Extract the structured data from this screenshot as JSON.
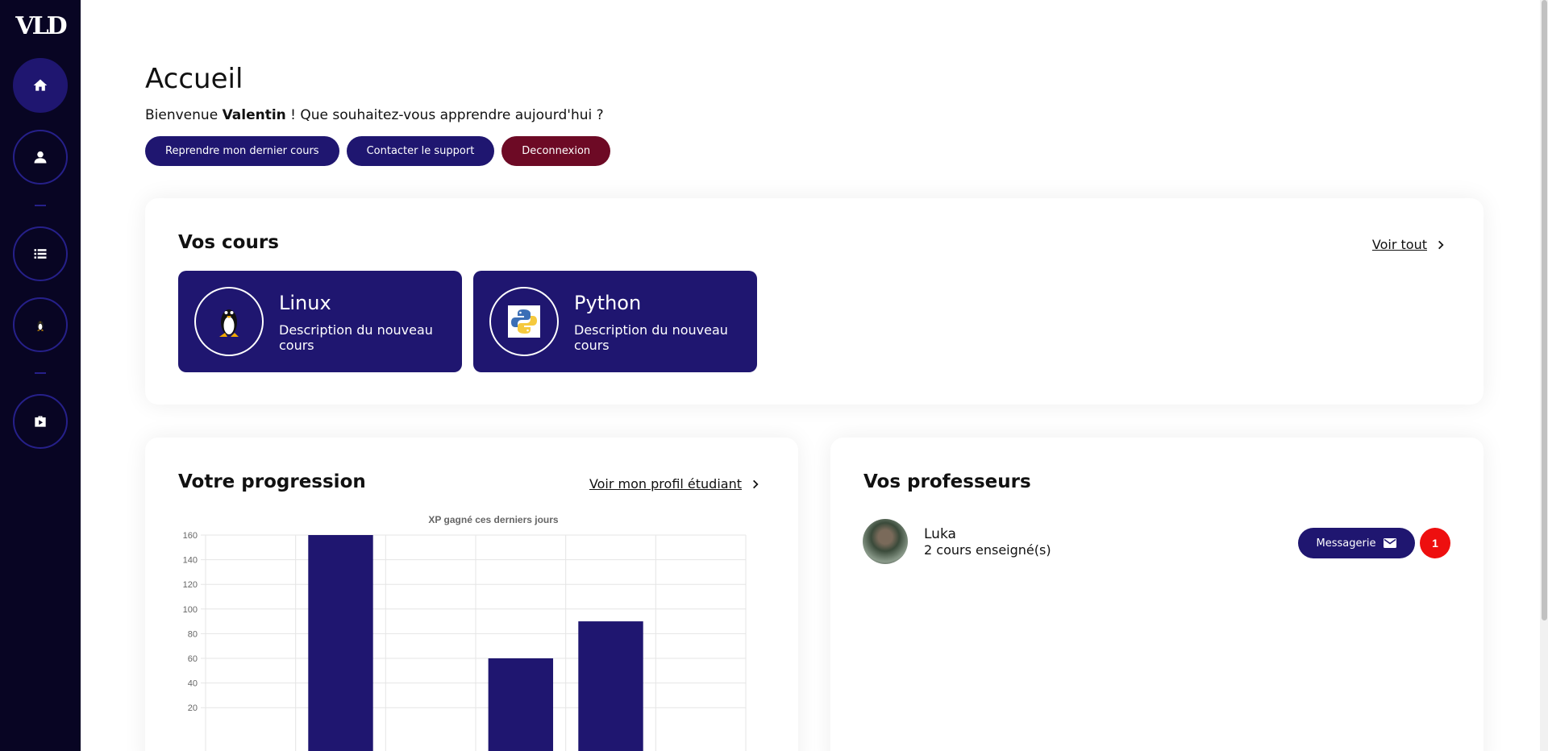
{
  "app": {
    "logo": "VLD"
  },
  "sidebar": {
    "items": [
      {
        "icon": "home-icon",
        "active": true
      },
      {
        "icon": "user-icon",
        "active": false
      },
      {
        "icon": "list-icon",
        "active": false
      },
      {
        "icon": "linux-icon",
        "active": false
      },
      {
        "icon": "briefcase-icon",
        "active": false
      }
    ]
  },
  "header": {
    "title": "Accueil",
    "welcome_prefix": "Bienvenue ",
    "user_name": "Valentin",
    "welcome_suffix": " ! Que souhaitez-vous apprendre aujourd'hui ?",
    "buttons": {
      "resume": "Reprendre mon dernier cours",
      "support": "Contacter le support",
      "logout": "Deconnexion"
    }
  },
  "courses": {
    "title": "Vos cours",
    "see_all": "Voir tout",
    "items": [
      {
        "name": "Linux",
        "description": "Description du nouveau cours",
        "icon": "linux-penguin-icon"
      },
      {
        "name": "Python",
        "description": "Description du nouveau cours",
        "icon": "python-logo-icon"
      }
    ]
  },
  "progress": {
    "title": "Votre progression",
    "link": "Voir mon profil étudiant"
  },
  "chart_data": {
    "type": "bar",
    "title": "XP gagné ces derniers jours",
    "categories": [
      "",
      "",
      "",
      "",
      "",
      ""
    ],
    "values": [
      null,
      160,
      null,
      60,
      90,
      null
    ],
    "yticks": [
      20,
      40,
      60,
      80,
      100,
      120,
      140,
      160
    ],
    "ylim": [
      0,
      160
    ],
    "grid": true,
    "bar_color": "#1f1670"
  },
  "teachers": {
    "title": "Vos professeurs",
    "items": [
      {
        "name": "Luka",
        "courses": "2 cours enseigné(s)",
        "message_label": "Messagerie",
        "unread": "1"
      }
    ]
  },
  "colors": {
    "sidebar_bg": "#080523",
    "primary": "#1f1670",
    "danger": "#6d0a25",
    "badge": "#ee0f0f"
  }
}
